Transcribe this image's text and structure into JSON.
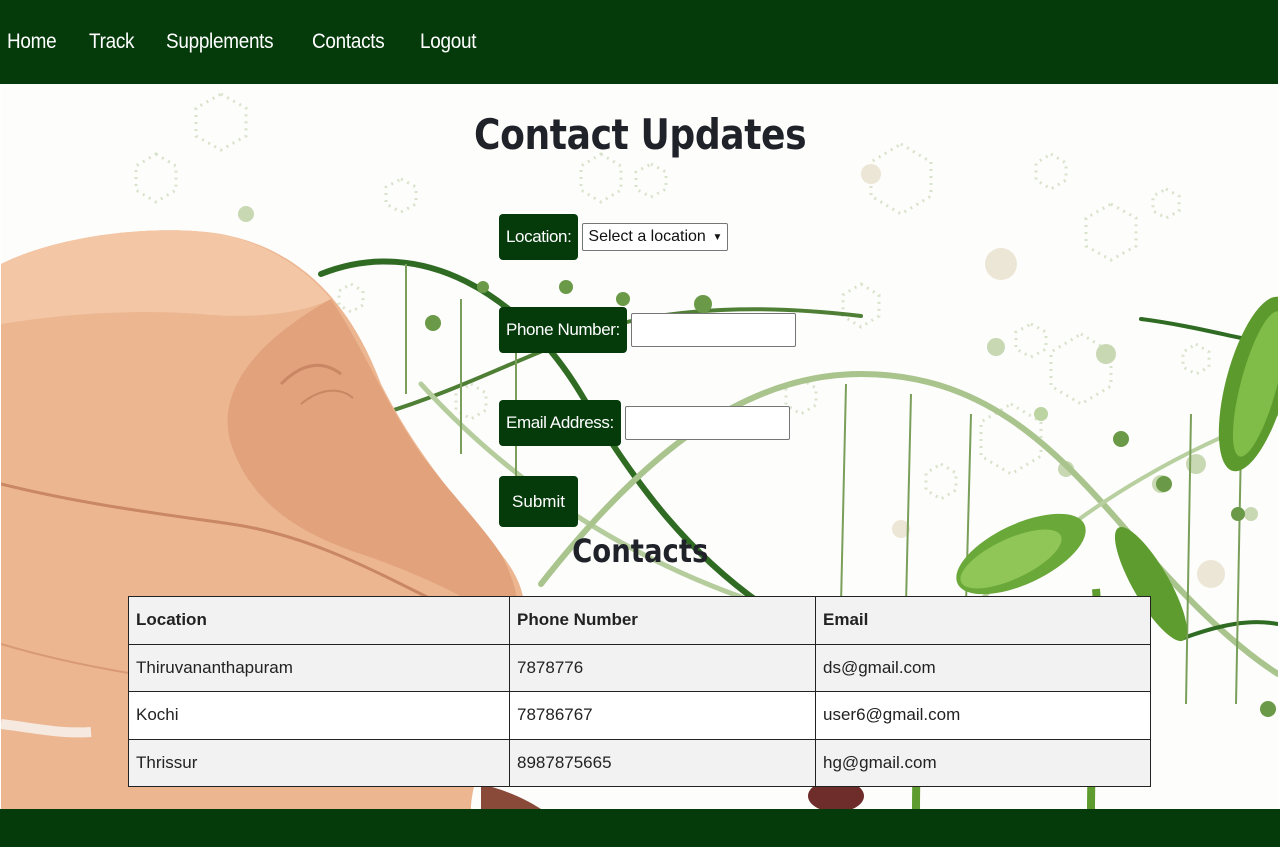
{
  "nav": {
    "items": [
      "Home",
      "Track",
      "Supplements",
      "Contacts",
      "Logout"
    ]
  },
  "page_title": "Contact Updates",
  "form": {
    "location_label": "Location:",
    "location_selected": "Select a location",
    "phone_label": "Phone Number:",
    "phone_value": "",
    "email_label": "Email Address:",
    "email_value": "",
    "submit_label": "Submit"
  },
  "contacts": {
    "title": "Contacts",
    "columns": [
      "Location",
      "Phone Number",
      "Email"
    ],
    "rows": [
      [
        "Thiruvananthapuram",
        "7878776",
        "ds@gmail.com"
      ],
      [
        "Kochi",
        "78786767",
        "user6@gmail.com"
      ],
      [
        "Thrissur",
        "8987875665",
        "hg@gmail.com"
      ]
    ]
  },
  "colors": {
    "brand_green": "#053a0b",
    "table_stripe": "#f2f2f2"
  }
}
